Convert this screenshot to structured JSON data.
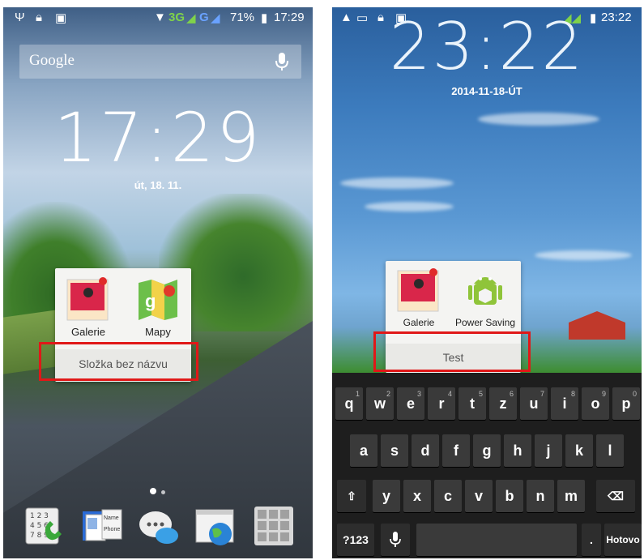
{
  "left": {
    "status": {
      "signal": "3G",
      "g": "G",
      "battery": "71%",
      "time": "17:29"
    },
    "search": {
      "label": "Google"
    },
    "clock": {
      "time": "17:29",
      "date": "út, 18. 11."
    },
    "folder": {
      "apps": [
        {
          "label": "Galerie"
        },
        {
          "label": "Mapy"
        }
      ],
      "name": "Složka bez názvu"
    },
    "dock": [
      {
        "icon": "dialer-icon"
      },
      {
        "icon": "contacts-icon"
      },
      {
        "icon": "messaging-icon"
      },
      {
        "icon": "browser-icon"
      },
      {
        "icon": "app-drawer-icon"
      }
    ],
    "contacts_card": {
      "name": "Name",
      "phone": "Phone"
    }
  },
  "right": {
    "status": {
      "time": "23:22"
    },
    "clock": {
      "time": "23:22",
      "date": "2014-11-18-ÚT"
    },
    "folder": {
      "apps": [
        {
          "label": "Galerie"
        },
        {
          "label": "Power Saving"
        }
      ],
      "name": "Test"
    },
    "keyboard": {
      "row1": [
        {
          "k": "q",
          "n": "1"
        },
        {
          "k": "w",
          "n": "2"
        },
        {
          "k": "e",
          "n": "3"
        },
        {
          "k": "r",
          "n": "4"
        },
        {
          "k": "t",
          "n": "5"
        },
        {
          "k": "z",
          "n": "6"
        },
        {
          "k": "u",
          "n": "7"
        },
        {
          "k": "i",
          "n": "8"
        },
        {
          "k": "o",
          "n": "9"
        },
        {
          "k": "p",
          "n": "0"
        }
      ],
      "row2": [
        "a",
        "s",
        "d",
        "f",
        "g",
        "h",
        "j",
        "k",
        "l"
      ],
      "row3": [
        "y",
        "x",
        "c",
        "v",
        "b",
        "n",
        "m"
      ],
      "symbols": "?123",
      "period": ".",
      "done": "Hotovo"
    }
  },
  "colors": {
    "highlight": "#e01818",
    "folder_bg": "#f4f4f2"
  }
}
